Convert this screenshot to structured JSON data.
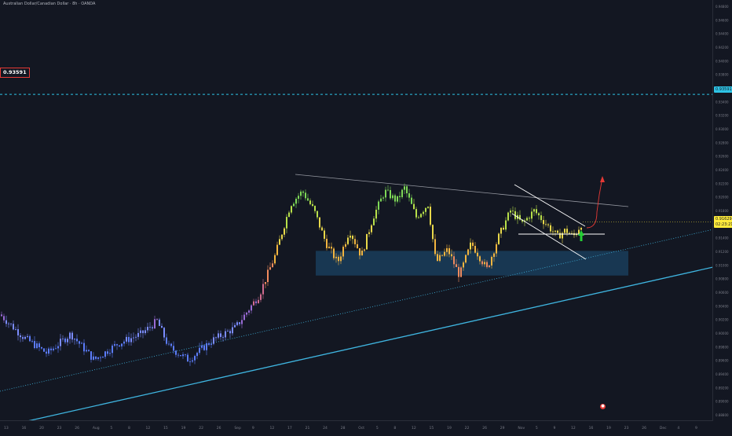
{
  "header": {
    "title": "Australian Dollar/Canadian Dollar · 8h · OANDA"
  },
  "alert_label": {
    "value": "0.93591"
  },
  "price_axis": {
    "ticks": [
      "0.94800",
      "0.94600",
      "0.94400",
      "0.94200",
      "0.94000",
      "0.93800",
      "0.93600",
      "0.93400",
      "0.93200",
      "0.93000",
      "0.92800",
      "0.92600",
      "0.92400",
      "0.92200",
      "0.92000",
      "0.91800",
      "0.91600",
      "0.91400",
      "0.91200",
      "0.91000",
      "0.90800",
      "0.90600",
      "0.90400",
      "0.90200",
      "0.90000",
      "0.89800",
      "0.89600",
      "0.89400",
      "0.89200",
      "0.89000",
      "0.88800"
    ],
    "current_price": "0.91629",
    "countdown": "02:23:21",
    "alert_price": "0.93591"
  },
  "time_axis": {
    "ticks": [
      "13",
      "16",
      "20",
      "23",
      "26",
      "Aug",
      "5",
      "8",
      "12",
      "15",
      "19",
      "22",
      "26",
      "Sep",
      "9",
      "12",
      "17",
      "21",
      "24",
      "28",
      "Oct",
      "5",
      "8",
      "12",
      "15",
      "19",
      "22",
      "26",
      "29",
      "Nov",
      "5",
      "9",
      "12",
      "16",
      "19",
      "23",
      "26",
      "Dec",
      "4",
      "9"
    ]
  },
  "colors": {
    "background": "#131722",
    "zone_fill": "#1e5f8f",
    "trendline": "#3fb5e0",
    "channel": "#ffffff",
    "up_arrow": "#26d035",
    "projection": "#e53935",
    "alert_line": "#2ec4e6"
  },
  "chart_data": {
    "type": "candlestick",
    "symbol": "AUDCAD",
    "timeframe": "8h",
    "ylim": [
      0.888,
      0.949
    ],
    "current_price": 0.91629,
    "alert_level": 0.93591,
    "support_zone": [
      0.908,
      0.9118
    ],
    "annotations": [
      "descending channel",
      "bullish breakout arrow",
      "projected move up"
    ],
    "grid": false
  },
  "icons": {
    "event": "calendar-event-icon"
  }
}
